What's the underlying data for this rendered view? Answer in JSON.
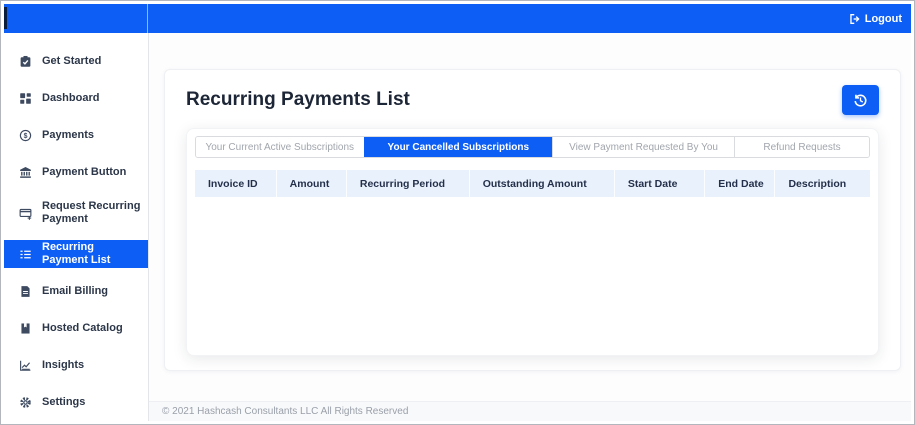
{
  "topbar": {
    "logout_label": "Logout",
    "logout_icon": "logout-icon"
  },
  "sidebar": {
    "active_item": "Recurring Payment List",
    "items": [
      {
        "label": "Get Started",
        "icon": "clipboard-check-icon"
      },
      {
        "label": "Dashboard",
        "icon": "grid-icon"
      },
      {
        "label": "Payments",
        "icon": "dollar-circle-icon"
      },
      {
        "label": "Payment Button",
        "icon": "bank-icon"
      },
      {
        "label": "Request Recurring Payment",
        "icon": "card-plus-icon"
      },
      {
        "label": "Recurring Payment List",
        "icon": "list-icon"
      },
      {
        "label": "Email Billing",
        "icon": "invoice-icon"
      },
      {
        "label": "Hosted Catalog",
        "icon": "book-icon"
      },
      {
        "label": "Insights",
        "icon": "chart-icon"
      },
      {
        "label": "Settings",
        "icon": "gear-icon"
      }
    ]
  },
  "main": {
    "title": "Recurring Payments List",
    "history_button_icon": "history-icon",
    "tabs": [
      {
        "label": "Your Current Active Subscriptions",
        "active": false
      },
      {
        "label": "Your Cancelled Subscriptions",
        "active": true
      },
      {
        "label": "View Payment Requested By You",
        "active": false
      },
      {
        "label": "Refund Requests",
        "active": false
      }
    ],
    "table": {
      "columns": [
        "Invoice ID",
        "Amount",
        "Recurring Period",
        "Outstanding Amount",
        "Start Date",
        "End Date",
        "Description"
      ],
      "rows": []
    },
    "footer": "© 2021 Hashcash Consultants LLC All Rights Reserved"
  },
  "colors": {
    "accent_blue": "#0d5ef4",
    "table_header_bg": "#e9f2fc",
    "inactive_tab_text": "#a1a6ad",
    "sidebar_text": "#2b3648"
  }
}
